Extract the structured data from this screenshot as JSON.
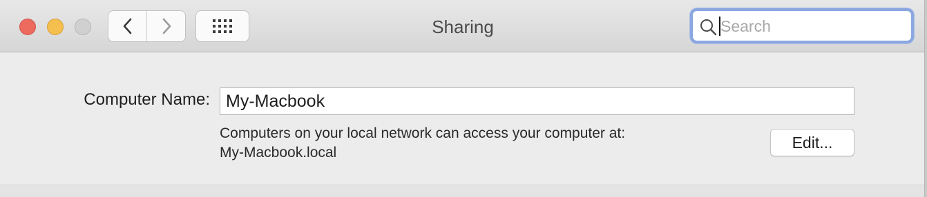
{
  "window": {
    "title": "Sharing"
  },
  "toolbar": {
    "back_icon": "chevron-left-icon",
    "forward_icon": "chevron-right-icon",
    "grid_icon": "grid-icon",
    "search_placeholder": "Search",
    "search_value": ""
  },
  "sharing": {
    "computer_name_label": "Computer Name:",
    "computer_name_value": "My-Macbook",
    "info_line1": "Computers on your local network can access your computer at:",
    "info_line2": "My-Macbook.local",
    "edit_label": "Edit..."
  },
  "colors": {
    "close": "#ec6a5e",
    "minimize": "#f4bf4f",
    "zoom_inactive": "#d0d0d0",
    "focus_ring": "#8aa7e0"
  }
}
